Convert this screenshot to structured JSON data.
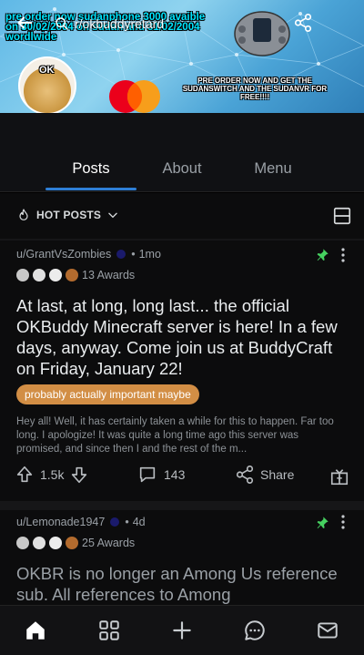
{
  "banner": {
    "cyan_text": "pre order now sudanphone 3000 avaible on 30/02/2004 on sudan and 31/02/2004 wordlwide",
    "promo_text": "PRE ORDER NOW AND GET THE SUDANSWITCH AND THE SUDANVR FOR FREE!!!!",
    "doge_text": "OK",
    "mc_text": "Mastercard"
  },
  "header": {
    "subreddit": "r/okbuddyretard"
  },
  "tabs": [
    {
      "label": "Posts",
      "active": true
    },
    {
      "label": "About",
      "active": false
    },
    {
      "label": "Menu",
      "active": false
    }
  ],
  "sort": {
    "label": "HOT POSTS"
  },
  "posts": [
    {
      "author": "u/GrantVsZombies",
      "age": "1mo",
      "awards": "13 Awards",
      "pinned": true,
      "title": "At last, at long, long last... the official OKBuddy Minecraft server is here! In a few days, anyway. Come join us at BuddyCraft on Friday, January 22!",
      "flair": "probably actually important maybe",
      "body": "Hey all! Well, it has certainly taken a while for this to happen. Far too long. I apologize! It was quite a long time ago this server was promised, and since then I and the rest of the m...",
      "votes": "1.5k",
      "comments": "143",
      "share_label": "Share"
    },
    {
      "author": "u/Lemonade1947",
      "age": "4d",
      "awards": "25 Awards",
      "pinned": true,
      "title": "OKBR is no longer an Among Us reference sub. All references to Among"
    }
  ],
  "colors": {
    "accent": "#2e7fd6",
    "flair_bg": "#d28e45",
    "pin": "#46d160",
    "background": "#0c0c0d"
  }
}
